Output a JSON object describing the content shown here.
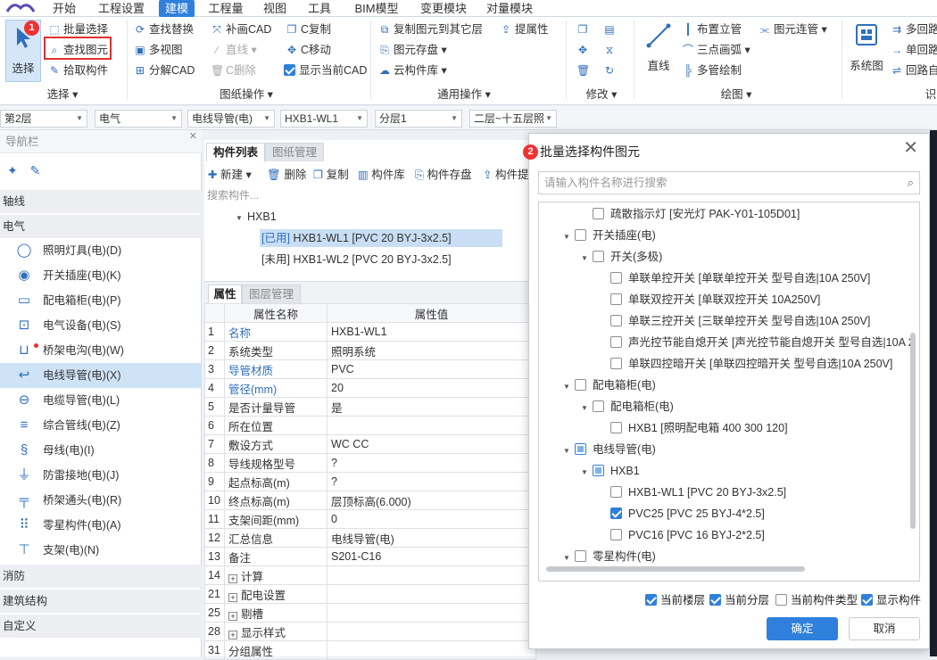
{
  "menubar": {
    "items": [
      "开始",
      "工程设置",
      "建模",
      "工程量",
      "视图",
      "工具",
      "BIM模型",
      "变更模块",
      "对量模块"
    ],
    "active": "建模"
  },
  "ribbon": {
    "select_group": {
      "big_button": "选择",
      "batch_select": "批量选择",
      "find_element": "查找图元",
      "pick_component": "拾取构件",
      "label": "选择"
    },
    "drawing_ops": {
      "find_replace": "查找替换",
      "multi_view": "多视图",
      "split_cad": "分解CAD",
      "patch_cad": "补画CAD",
      "straight_line": "直线",
      "c_delete": "C删除",
      "c_copy": "C复制",
      "c_move": "C移动",
      "show_current_cad": "显示当前CAD",
      "label": "图纸操作"
    },
    "common_ops": {
      "copy_to_other_layer": "复制图元到其它层",
      "extract_attr": "提属性",
      "element_save": "图元存盘",
      "cloud_library": "云构件库",
      "label": "通用操作"
    },
    "modify": {
      "label": "修改"
    },
    "draw": {
      "line": "直线",
      "arrange_riser": "布置立管",
      "connect_pipe": "图元连管",
      "three_point_arc": "三点画弧",
      "multi_pipe_draw": "多管绘制",
      "label": "绘图"
    },
    "system_view": "系统图",
    "right_cut": [
      "多回路",
      "单回路",
      "回路自"
    ],
    "right_label": "识"
  },
  "filterbar": {
    "floor": "第2层",
    "discipline": "电气",
    "component_type": "电线导管(电)",
    "component": "HXB1-WL1",
    "sublayer": "分层1",
    "floor_range": "二层~十五层照"
  },
  "nav": {
    "title": "导航栏",
    "categories": {
      "axis": "轴线",
      "electric": "电气",
      "fire": "消防",
      "structure": "建筑结构",
      "custom": "自定义"
    },
    "items": [
      {
        "label": "照明灯具(电)(D)",
        "icon": "bulb-icon"
      },
      {
        "label": "开关插座(电)(K)",
        "icon": "switch-icon"
      },
      {
        "label": "配电箱柜(电)(P)",
        "icon": "panel-icon"
      },
      {
        "label": "电气设备(电)(S)",
        "icon": "device-icon"
      },
      {
        "label": "桥架电沟(电)(W)",
        "icon": "tray-icon"
      },
      {
        "label": "电线导管(电)(X)",
        "icon": "conduit-icon"
      },
      {
        "label": "电缆导管(电)(L)",
        "icon": "cable-icon"
      },
      {
        "label": "综合管线(电)(Z)",
        "icon": "pipeline-icon"
      },
      {
        "label": "母线(电)(I)",
        "icon": "busbar-icon"
      },
      {
        "label": "防雷接地(电)(J)",
        "icon": "ground-icon"
      },
      {
        "label": "桥架通头(电)(R)",
        "icon": "tee-icon"
      },
      {
        "label": "零星构件(电)(A)",
        "icon": "misc-icon"
      },
      {
        "label": "支架(电)(N)",
        "icon": "bracket-icon"
      }
    ]
  },
  "component_panel": {
    "tab_list": "构件列表",
    "tab_drawing": "图纸管理",
    "toolbar": {
      "new": "新建",
      "delete": "删除",
      "copy": "复制",
      "library": "构件库",
      "save": "构件存盘",
      "extract": "构件提"
    },
    "search_placeholder": "搜索构件...",
    "tree_root": "HXB1",
    "tree_items": [
      {
        "status": "[已用]",
        "label": "HXB1-WL1 [PVC 20 BYJ-3x2.5]"
      },
      {
        "status": "[未用]",
        "label": "HXB1-WL2 [PVC 20 BYJ-3x2.5]"
      }
    ]
  },
  "properties": {
    "tab_props": "属性",
    "tab_layers": "图层管理",
    "col_name": "属性名称",
    "col_value": "属性值",
    "rows": [
      {
        "n": "1",
        "name": "名称",
        "value": "HXB1-WL1"
      },
      {
        "n": "2",
        "name": "系统类型",
        "value": "照明系统"
      },
      {
        "n": "3",
        "name": "导管材质",
        "value": "PVC"
      },
      {
        "n": "4",
        "name": "管径(mm)",
        "value": "20"
      },
      {
        "n": "5",
        "name": "是否计量导管",
        "value": "是"
      },
      {
        "n": "6",
        "name": "所在位置",
        "value": ""
      },
      {
        "n": "7",
        "name": "敷设方式",
        "value": "WC CC"
      },
      {
        "n": "8",
        "name": "导线规格型号",
        "value": "?"
      },
      {
        "n": "9",
        "name": "起点标高(m)",
        "value": "?"
      },
      {
        "n": "10",
        "name": "终点标高(m)",
        "value": "层顶标高(6.000)"
      },
      {
        "n": "11",
        "name": "支架间距(mm)",
        "value": "0"
      },
      {
        "n": "12",
        "name": "汇总信息",
        "value": "电线导管(电)"
      },
      {
        "n": "13",
        "name": "备注",
        "value": "S201-C16"
      },
      {
        "n": "14",
        "name": "计算",
        "value": ""
      },
      {
        "n": "21",
        "name": "配电设置",
        "value": ""
      },
      {
        "n": "25",
        "name": "剔槽",
        "value": ""
      },
      {
        "n": "28",
        "name": "显示样式",
        "value": ""
      },
      {
        "n": "31",
        "name": "分组属性",
        "value": ""
      }
    ]
  },
  "dialog": {
    "title": "批量选择构件图元",
    "search_placeholder": "请输入构件名称进行搜索",
    "tree": [
      {
        "label": "疏散指示灯 [安光灯 PAK-Y01-105D01]",
        "state": "none"
      },
      {
        "label": "开关插座(电)",
        "state": "none"
      },
      {
        "label": "开关(多极)",
        "state": "none"
      },
      {
        "label": "单联单控开关 [单联单控开关 型号自选|10A 250V]",
        "state": "none"
      },
      {
        "label": "单联双控开关 [单联双控开关 10A250V]",
        "state": "none"
      },
      {
        "label": "单联三控开关 [三联单控开关 型号自选|10A 250V]",
        "state": "none"
      },
      {
        "label": "声光控节能自熄开关 [声光控节能自熄开关 型号自选|10A 2",
        "state": "none"
      },
      {
        "label": "单联四控暗开关 [单联四控暗开关 型号自选|10A 250V]",
        "state": "none"
      },
      {
        "label": "配电箱柜(电)",
        "state": "none"
      },
      {
        "label": "配电箱柜(电)",
        "state": "none"
      },
      {
        "label": "HXB1 [照明配电箱 400 300 120]",
        "state": "none"
      },
      {
        "label": "电线导管(电)",
        "state": "partial"
      },
      {
        "label": "HXB1",
        "state": "partial"
      },
      {
        "label": "HXB1-WL1 [PVC 20 BYJ-3x2.5]",
        "state": "none"
      },
      {
        "label": "PVC25 [PVC 25 BYJ-4*2.5]",
        "state": "checked"
      },
      {
        "label": "PVC16 [PVC 16 BYJ-2*2.5]",
        "state": "none"
      },
      {
        "label": "零星构件(电)",
        "state": "none"
      }
    ],
    "options": [
      {
        "label": "当前楼层",
        "checked": true
      },
      {
        "label": "当前分层",
        "checked": true
      },
      {
        "label": "当前构件类型",
        "checked": false
      },
      {
        "label": "显示构件",
        "checked": true
      }
    ],
    "ok": "确定",
    "cancel": "取消"
  },
  "badges": {
    "one": "1",
    "two": "2"
  },
  "colors": {
    "accent": "#2f80dc",
    "badge": "#e33333",
    "selected_row": "#cfe3f7"
  }
}
